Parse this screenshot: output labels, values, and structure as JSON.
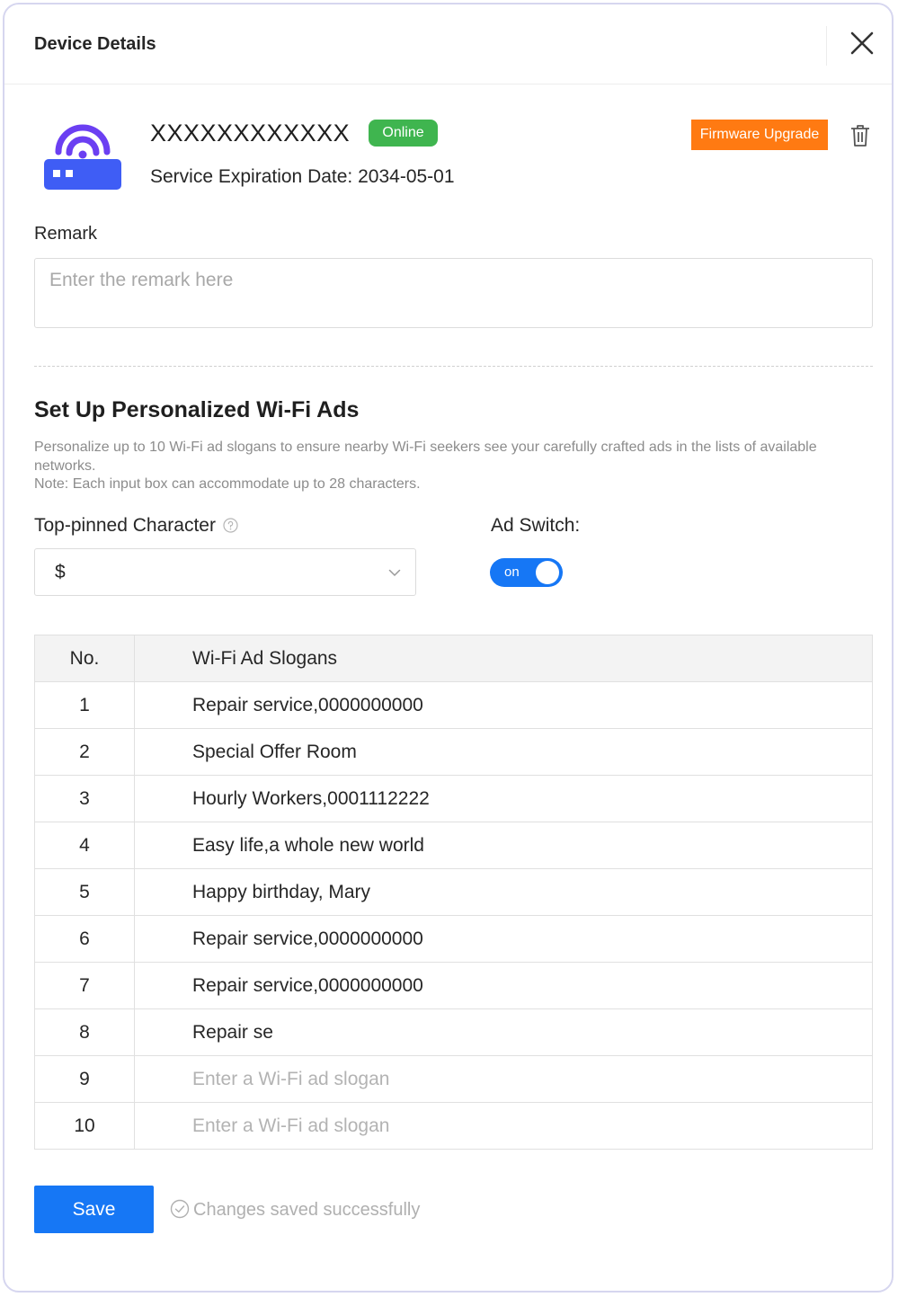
{
  "dialog": {
    "title": "Device Details"
  },
  "device": {
    "name": "XXXXXXXXXXXX",
    "status": "Online",
    "expiration": "Service Expiration Date: 2034-05-01",
    "firmware_button": "Firmware Upgrade"
  },
  "remark": {
    "label": "Remark",
    "placeholder": "Enter the remark here",
    "value": ""
  },
  "wifi_ads": {
    "title": "Set Up Personalized Wi-Fi Ads",
    "description": "Personalize up to 10 Wi-Fi ad slogans to ensure nearby Wi-Fi seekers see your carefully crafted ads in the lists of available networks.",
    "note": "Note: Each input box can accommodate up to 28 characters.",
    "pin_label": "Top-pinned Character",
    "pin_value": "$",
    "ad_switch_label": "Ad Switch:",
    "ad_switch_text": "on",
    "table": {
      "headers": [
        "No.",
        "Wi-Fi Ad Slogans"
      ],
      "placeholder": "Enter a Wi-Fi ad slogan",
      "rows": [
        {
          "no": "1",
          "slogan": "Repair service,0000000000"
        },
        {
          "no": "2",
          "slogan": "Special Offer Room"
        },
        {
          "no": "3",
          "slogan": "Hourly Workers,0001112222"
        },
        {
          "no": "4",
          "slogan": "Easy life,a whole new world"
        },
        {
          "no": "5",
          "slogan": "Happy birthday, Mary"
        },
        {
          "no": "6",
          "slogan": "Repair service,0000000000"
        },
        {
          "no": "7",
          "slogan": "Repair service,0000000000"
        },
        {
          "no": "8",
          "slogan": "Repair se"
        },
        {
          "no": "9",
          "slogan": ""
        },
        {
          "no": "10",
          "slogan": ""
        }
      ]
    }
  },
  "footer": {
    "save_label": "Save",
    "saved_message": "Changes saved successfully"
  },
  "colors": {
    "primary": "#1677f5",
    "status_online": "#3fb54f",
    "firmware": "#ff7a12"
  }
}
